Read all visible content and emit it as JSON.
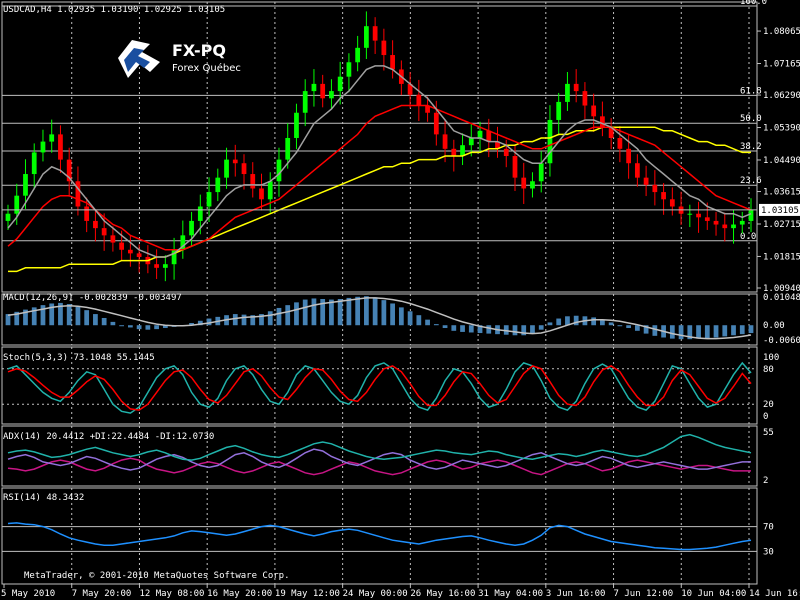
{
  "header": {
    "symbol_line": "USDCAD,H4  1.02935 1.03190 1.02925 1.03105"
  },
  "logo": {
    "title": "FX-PQ",
    "subtitle": "Forex Québec"
  },
  "footer": {
    "copyright": "MetaTrader, © 2001-2010 MetaQuotes Software Corp."
  },
  "chart_data": [
    {
      "type": "candlestick",
      "title": "USDCAD,H4",
      "ohlc": {
        "open": 1.02935,
        "high": 1.0319,
        "low": 1.02925,
        "close": 1.03105
      },
      "current_price": "1.03105",
      "ylim": [
        1.0094,
        1.0876
      ],
      "y_ticks": [
        "1.08065",
        "1.07165",
        "1.06290",
        "1.05390",
        "1.04490",
        "1.03615",
        "1.02715",
        "1.01815",
        "1.00940"
      ],
      "x_ticks": [
        "5 May 2010",
        "7 May 20:00",
        "12 May 08:00",
        "16 May 20:00",
        "19 May 12:00",
        "24 May 00:00",
        "26 May 16:00",
        "31 May 04:00",
        "3 Jun 16:00",
        "7 Jun 12:00",
        "10 Jun 04:00",
        "14 Jun 16:00"
      ],
      "fibonacci_levels": [
        {
          "label": "100.0",
          "price": 1.0876
        },
        {
          "label": "61.8",
          "price": 1.0628
        },
        {
          "label": "50.0",
          "price": 1.0551
        },
        {
          "label": "38.2",
          "price": 1.0474
        },
        {
          "label": "23.6",
          "price": 1.0379
        },
        {
          "label": "0.0",
          "price": 1.0225
        }
      ],
      "close_series": [
        1.03,
        1.035,
        1.041,
        1.047,
        1.05,
        1.052,
        1.045,
        1.039,
        1.032,
        1.028,
        1.026,
        1.024,
        1.022,
        1.02,
        1.019,
        1.018,
        1.016,
        1.015,
        1.016,
        1.02,
        1.024,
        1.028,
        1.032,
        1.036,
        1.04,
        1.045,
        1.044,
        1.041,
        1.037,
        1.034,
        1.039,
        1.045,
        1.051,
        1.058,
        1.064,
        1.066,
        1.062,
        1.064,
        1.068,
        1.072,
        1.076,
        1.082,
        1.078,
        1.074,
        1.07,
        1.066,
        1.063,
        1.06,
        1.058,
        1.052,
        1.048,
        1.046,
        1.049,
        1.051,
        1.053,
        1.05,
        1.048,
        1.046,
        1.04,
        1.037,
        1.039,
        1.044,
        1.056,
        1.061,
        1.066,
        1.064,
        1.06,
        1.057,
        1.054,
        1.051,
        1.048,
        1.044,
        1.04,
        1.038,
        1.036,
        1.034,
        1.032,
        1.03,
        1.03,
        1.029,
        1.028,
        1.027,
        1.026,
        1.027,
        1.028,
        1.031
      ],
      "ma_fast": [
        1.026,
        1.029,
        1.033,
        1.037,
        1.041,
        1.043,
        1.042,
        1.04,
        1.037,
        1.034,
        1.031,
        1.028,
        1.026,
        1.024,
        1.022,
        1.02,
        1.019,
        1.018,
        1.018,
        1.019,
        1.021,
        1.023,
        1.026,
        1.029,
        1.032,
        1.035,
        1.037,
        1.038,
        1.038,
        1.038,
        1.039,
        1.041,
        1.044,
        1.047,
        1.051,
        1.055,
        1.057,
        1.059,
        1.062,
        1.064,
        1.067,
        1.07,
        1.071,
        1.071,
        1.07,
        1.068,
        1.066,
        1.064,
        1.062,
        1.059,
        1.056,
        1.053,
        1.052,
        1.051,
        1.051,
        1.05,
        1.05,
        1.049,
        1.047,
        1.045,
        1.044,
        1.044,
        1.047,
        1.05,
        1.053,
        1.055,
        1.056,
        1.056,
        1.055,
        1.054,
        1.052,
        1.05,
        1.048,
        1.045,
        1.043,
        1.041,
        1.039,
        1.037,
        1.035,
        1.034,
        1.032,
        1.031,
        1.03,
        1.03,
        1.029,
        1.03
      ],
      "ma_slow": [
        1.021,
        1.023,
        1.026,
        1.029,
        1.032,
        1.034,
        1.035,
        1.035,
        1.034,
        1.033,
        1.031,
        1.029,
        1.027,
        1.026,
        1.024,
        1.023,
        1.022,
        1.021,
        1.02,
        1.02,
        1.02,
        1.021,
        1.022,
        1.023,
        1.025,
        1.027,
        1.029,
        1.03,
        1.031,
        1.032,
        1.033,
        1.034,
        1.036,
        1.038,
        1.04,
        1.042,
        1.044,
        1.046,
        1.048,
        1.05,
        1.052,
        1.055,
        1.057,
        1.058,
        1.059,
        1.06,
        1.06,
        1.06,
        1.06,
        1.059,
        1.058,
        1.057,
        1.056,
        1.055,
        1.054,
        1.053,
        1.052,
        1.051,
        1.05,
        1.049,
        1.048,
        1.048,
        1.049,
        1.05,
        1.051,
        1.052,
        1.053,
        1.054,
        1.054,
        1.054,
        1.053,
        1.052,
        1.051,
        1.05,
        1.049,
        1.047,
        1.045,
        1.043,
        1.041,
        1.039,
        1.037,
        1.035,
        1.034,
        1.033,
        1.032,
        1.031
      ],
      "ma_long": [
        1.014,
        1.014,
        1.015,
        1.015,
        1.015,
        1.015,
        1.015,
        1.016,
        1.016,
        1.016,
        1.016,
        1.016,
        1.016,
        1.017,
        1.017,
        1.017,
        1.017,
        1.018,
        1.018,
        1.019,
        1.02,
        1.021,
        1.022,
        1.023,
        1.024,
        1.025,
        1.026,
        1.027,
        1.028,
        1.029,
        1.03,
        1.031,
        1.032,
        1.033,
        1.034,
        1.035,
        1.036,
        1.037,
        1.038,
        1.039,
        1.04,
        1.041,
        1.042,
        1.043,
        1.043,
        1.044,
        1.044,
        1.045,
        1.045,
        1.045,
        1.046,
        1.046,
        1.046,
        1.047,
        1.047,
        1.048,
        1.048,
        1.049,
        1.049,
        1.05,
        1.05,
        1.051,
        1.051,
        1.052,
        1.052,
        1.053,
        1.053,
        1.053,
        1.054,
        1.054,
        1.054,
        1.054,
        1.054,
        1.054,
        1.054,
        1.053,
        1.053,
        1.052,
        1.051,
        1.05,
        1.05,
        1.049,
        1.049,
        1.048,
        1.047,
        1.047
      ],
      "colors": {
        "up": "#00ff00",
        "down": "#ff0000",
        "ma_fast": "#a0a0a0",
        "ma_slow": "#ff0000",
        "ma_long": "#ffff00",
        "fib": "#c0c0c0",
        "grid": "#c0c0c0"
      }
    },
    {
      "type": "bar",
      "title": "MACD(12,26,9) -0.002839 -0.003497",
      "y_ticks": [
        "0.010481",
        "0.00",
        "-0.006014"
      ],
      "ylim": [
        -0.006014,
        0.010481
      ],
      "histogram": [
        0.004,
        0.0048,
        0.0056,
        0.0064,
        0.0072,
        0.0078,
        0.008,
        0.0076,
        0.0066,
        0.0054,
        0.004,
        0.0026,
        0.0012,
        0.0,
        -0.0008,
        -0.0014,
        -0.0016,
        -0.0014,
        -0.001,
        -0.0006,
        0.0,
        0.0008,
        0.0016,
        0.0024,
        0.003,
        0.0036,
        0.004,
        0.0038,
        0.0036,
        0.004,
        0.005,
        0.0062,
        0.0072,
        0.0082,
        0.0092,
        0.0096,
        0.0094,
        0.0092,
        0.0094,
        0.0098,
        0.0102,
        0.0104,
        0.01,
        0.009,
        0.0078,
        0.0064,
        0.005,
        0.0036,
        0.002,
        0.0004,
        -0.001,
        -0.002,
        -0.0024,
        -0.0026,
        -0.0028,
        -0.003,
        -0.0032,
        -0.0034,
        -0.0036,
        -0.0036,
        -0.003,
        -0.0016,
        0.001,
        0.0024,
        0.0032,
        0.0034,
        0.0032,
        0.0028,
        0.002,
        0.001,
        0.0,
        -0.001,
        -0.002,
        -0.003,
        -0.0038,
        -0.0044,
        -0.0048,
        -0.005,
        -0.005,
        -0.0048,
        -0.0046,
        -0.0044,
        -0.004,
        -0.0036,
        -0.0032,
        -0.0028
      ],
      "signal": [
        0.0036,
        0.004,
        0.0046,
        0.0052,
        0.0058,
        0.0064,
        0.0068,
        0.007,
        0.0068,
        0.0064,
        0.0058,
        0.005,
        0.0042,
        0.0034,
        0.0026,
        0.0018,
        0.001,
        0.0004,
        0.0,
        -0.0002,
        -0.0002,
        0.0,
        0.0004,
        0.0008,
        0.0014,
        0.002,
        0.0024,
        0.0028,
        0.003,
        0.0032,
        0.0036,
        0.0042,
        0.0048,
        0.0056,
        0.0064,
        0.0072,
        0.0078,
        0.0082,
        0.0086,
        0.009,
        0.0094,
        0.0098,
        0.0098,
        0.0096,
        0.0092,
        0.0086,
        0.0078,
        0.0068,
        0.0058,
        0.0046,
        0.0034,
        0.0022,
        0.0012,
        0.0004,
        -0.0004,
        -0.001,
        -0.0016,
        -0.002,
        -0.0024,
        -0.0028,
        -0.003,
        -0.0028,
        -0.002,
        -0.001,
        0.0,
        0.001,
        0.0016,
        0.002,
        0.002,
        0.0018,
        0.0014,
        0.0008,
        0.0002,
        -0.0006,
        -0.0014,
        -0.0022,
        -0.003,
        -0.0036,
        -0.0042,
        -0.0046,
        -0.0048,
        -0.0048,
        -0.0046,
        -0.0044,
        -0.004,
        -0.0035
      ],
      "colors": {
        "histogram": "#4682b4",
        "signal": "#c0c0c0"
      }
    },
    {
      "type": "line",
      "title": "Stoch(5,3,3) 73.1048 55.1445",
      "ylim": [
        0,
        100
      ],
      "y_ticks": [
        "100",
        "80",
        "20",
        "0"
      ],
      "main": [
        80,
        85,
        70,
        55,
        40,
        30,
        25,
        40,
        60,
        75,
        70,
        45,
        20,
        8,
        5,
        15,
        40,
        65,
        80,
        85,
        70,
        40,
        20,
        15,
        30,
        60,
        80,
        85,
        70,
        45,
        25,
        20,
        40,
        70,
        85,
        80,
        60,
        40,
        25,
        20,
        35,
        65,
        85,
        90,
        80,
        55,
        30,
        15,
        10,
        30,
        60,
        80,
        75,
        55,
        30,
        15,
        20,
        45,
        75,
        90,
        85,
        60,
        30,
        15,
        10,
        25,
        55,
        80,
        88,
        80,
        55,
        30,
        15,
        10,
        25,
        55,
        85,
        80,
        55,
        30,
        15,
        20,
        45,
        70,
        90,
        73
      ],
      "signal": [
        75,
        80,
        76,
        65,
        52,
        40,
        32,
        32,
        44,
        58,
        68,
        62,
        45,
        25,
        12,
        10,
        20,
        40,
        60,
        75,
        78,
        65,
        45,
        28,
        22,
        35,
        55,
        75,
        80,
        68,
        48,
        32,
        28,
        45,
        65,
        80,
        78,
        62,
        42,
        28,
        25,
        40,
        62,
        80,
        85,
        75,
        55,
        33,
        18,
        18,
        35,
        58,
        75,
        72,
        55,
        35,
        22,
        28,
        50,
        72,
        85,
        80,
        58,
        35,
        20,
        18,
        32,
        58,
        78,
        85,
        75,
        52,
        32,
        18,
        18,
        32,
        60,
        78,
        70,
        50,
        30,
        22,
        30,
        50,
        72,
        55
      ],
      "colors": {
        "main": "#20b2aa",
        "signal": "#ff0000",
        "level": "#c0c0c0"
      }
    },
    {
      "type": "line",
      "title": "ADX(14) 20.4412 +DI:22.4484 -DI:12.0730",
      "y_ticks": [
        "55",
        "2"
      ],
      "ylim": [
        2,
        55
      ],
      "adx": [
        32,
        34,
        35,
        33,
        30,
        27,
        28,
        30,
        33,
        36,
        38,
        35,
        32,
        30,
        28,
        30,
        33,
        35,
        32,
        28,
        25,
        24,
        26,
        30,
        34,
        38,
        40,
        37,
        33,
        30,
        28,
        27,
        30,
        34,
        38,
        42,
        44,
        42,
        38,
        34,
        31,
        28,
        26,
        25,
        26,
        27,
        29,
        31,
        33,
        35,
        34,
        32,
        31,
        30,
        32,
        34,
        33,
        30,
        28,
        26,
        25,
        27,
        29,
        31,
        30,
        28,
        30,
        33,
        35,
        33,
        31,
        29,
        28,
        30,
        34,
        38,
        44,
        50,
        52,
        49,
        45,
        41,
        38,
        36,
        34,
        32
      ],
      "plus_di": [
        25,
        28,
        30,
        27,
        22,
        20,
        18,
        20,
        24,
        28,
        26,
        22,
        18,
        15,
        13,
        15,
        20,
        25,
        28,
        30,
        27,
        22,
        18,
        16,
        18,
        24,
        30,
        32,
        28,
        22,
        18,
        16,
        20,
        26,
        32,
        36,
        34,
        28,
        24,
        20,
        18,
        22,
        26,
        30,
        32,
        30,
        24,
        20,
        16,
        14,
        16,
        20,
        24,
        22,
        20,
        18,
        16,
        18,
        22,
        26,
        30,
        32,
        28,
        24,
        20,
        18,
        20,
        24,
        28,
        26,
        22,
        18,
        16,
        18,
        20,
        22,
        20,
        18,
        16,
        14,
        14,
        16,
        18,
        20,
        22,
        22
      ],
      "minus_di": [
        15,
        14,
        12,
        14,
        18,
        22,
        24,
        22,
        18,
        14,
        12,
        15,
        20,
        24,
        26,
        24,
        18,
        14,
        12,
        10,
        12,
        16,
        20,
        22,
        20,
        16,
        12,
        10,
        12,
        16,
        20,
        22,
        18,
        14,
        10,
        8,
        10,
        14,
        18,
        22,
        20,
        16,
        12,
        10,
        8,
        10,
        14,
        18,
        22,
        24,
        22,
        18,
        14,
        16,
        20,
        22,
        24,
        22,
        18,
        14,
        10,
        8,
        12,
        16,
        20,
        22,
        20,
        16,
        12,
        14,
        18,
        22,
        24,
        22,
        20,
        18,
        16,
        14,
        16,
        18,
        18,
        16,
        14,
        12,
        12,
        12
      ],
      "colors": {
        "adx": "#20b2aa",
        "plus_di": "#9370db",
        "minus_di": "#c71585"
      }
    },
    {
      "type": "line",
      "title": "RSI(14) 48.3432",
      "ylim": [
        0,
        100
      ],
      "y_ticks": [
        "70",
        "30"
      ],
      "rsi": [
        75,
        76,
        74,
        73,
        70,
        65,
        58,
        52,
        48,
        45,
        42,
        40,
        40,
        42,
        44,
        46,
        48,
        50,
        52,
        55,
        60,
        63,
        62,
        60,
        58,
        56,
        58,
        62,
        66,
        70,
        72,
        70,
        66,
        62,
        58,
        55,
        58,
        62,
        64,
        66,
        64,
        60,
        56,
        52,
        48,
        46,
        44,
        42,
        45,
        48,
        50,
        52,
        54,
        55,
        52,
        48,
        45,
        42,
        40,
        42,
        48,
        56,
        68,
        72,
        70,
        64,
        58,
        54,
        50,
        46,
        44,
        42,
        40,
        38,
        36,
        35,
        34,
        33,
        33,
        34,
        35,
        37,
        40,
        43,
        46,
        48
      ],
      "colors": {
        "line": "#1e90ff",
        "level": "#c0c0c0"
      }
    }
  ]
}
